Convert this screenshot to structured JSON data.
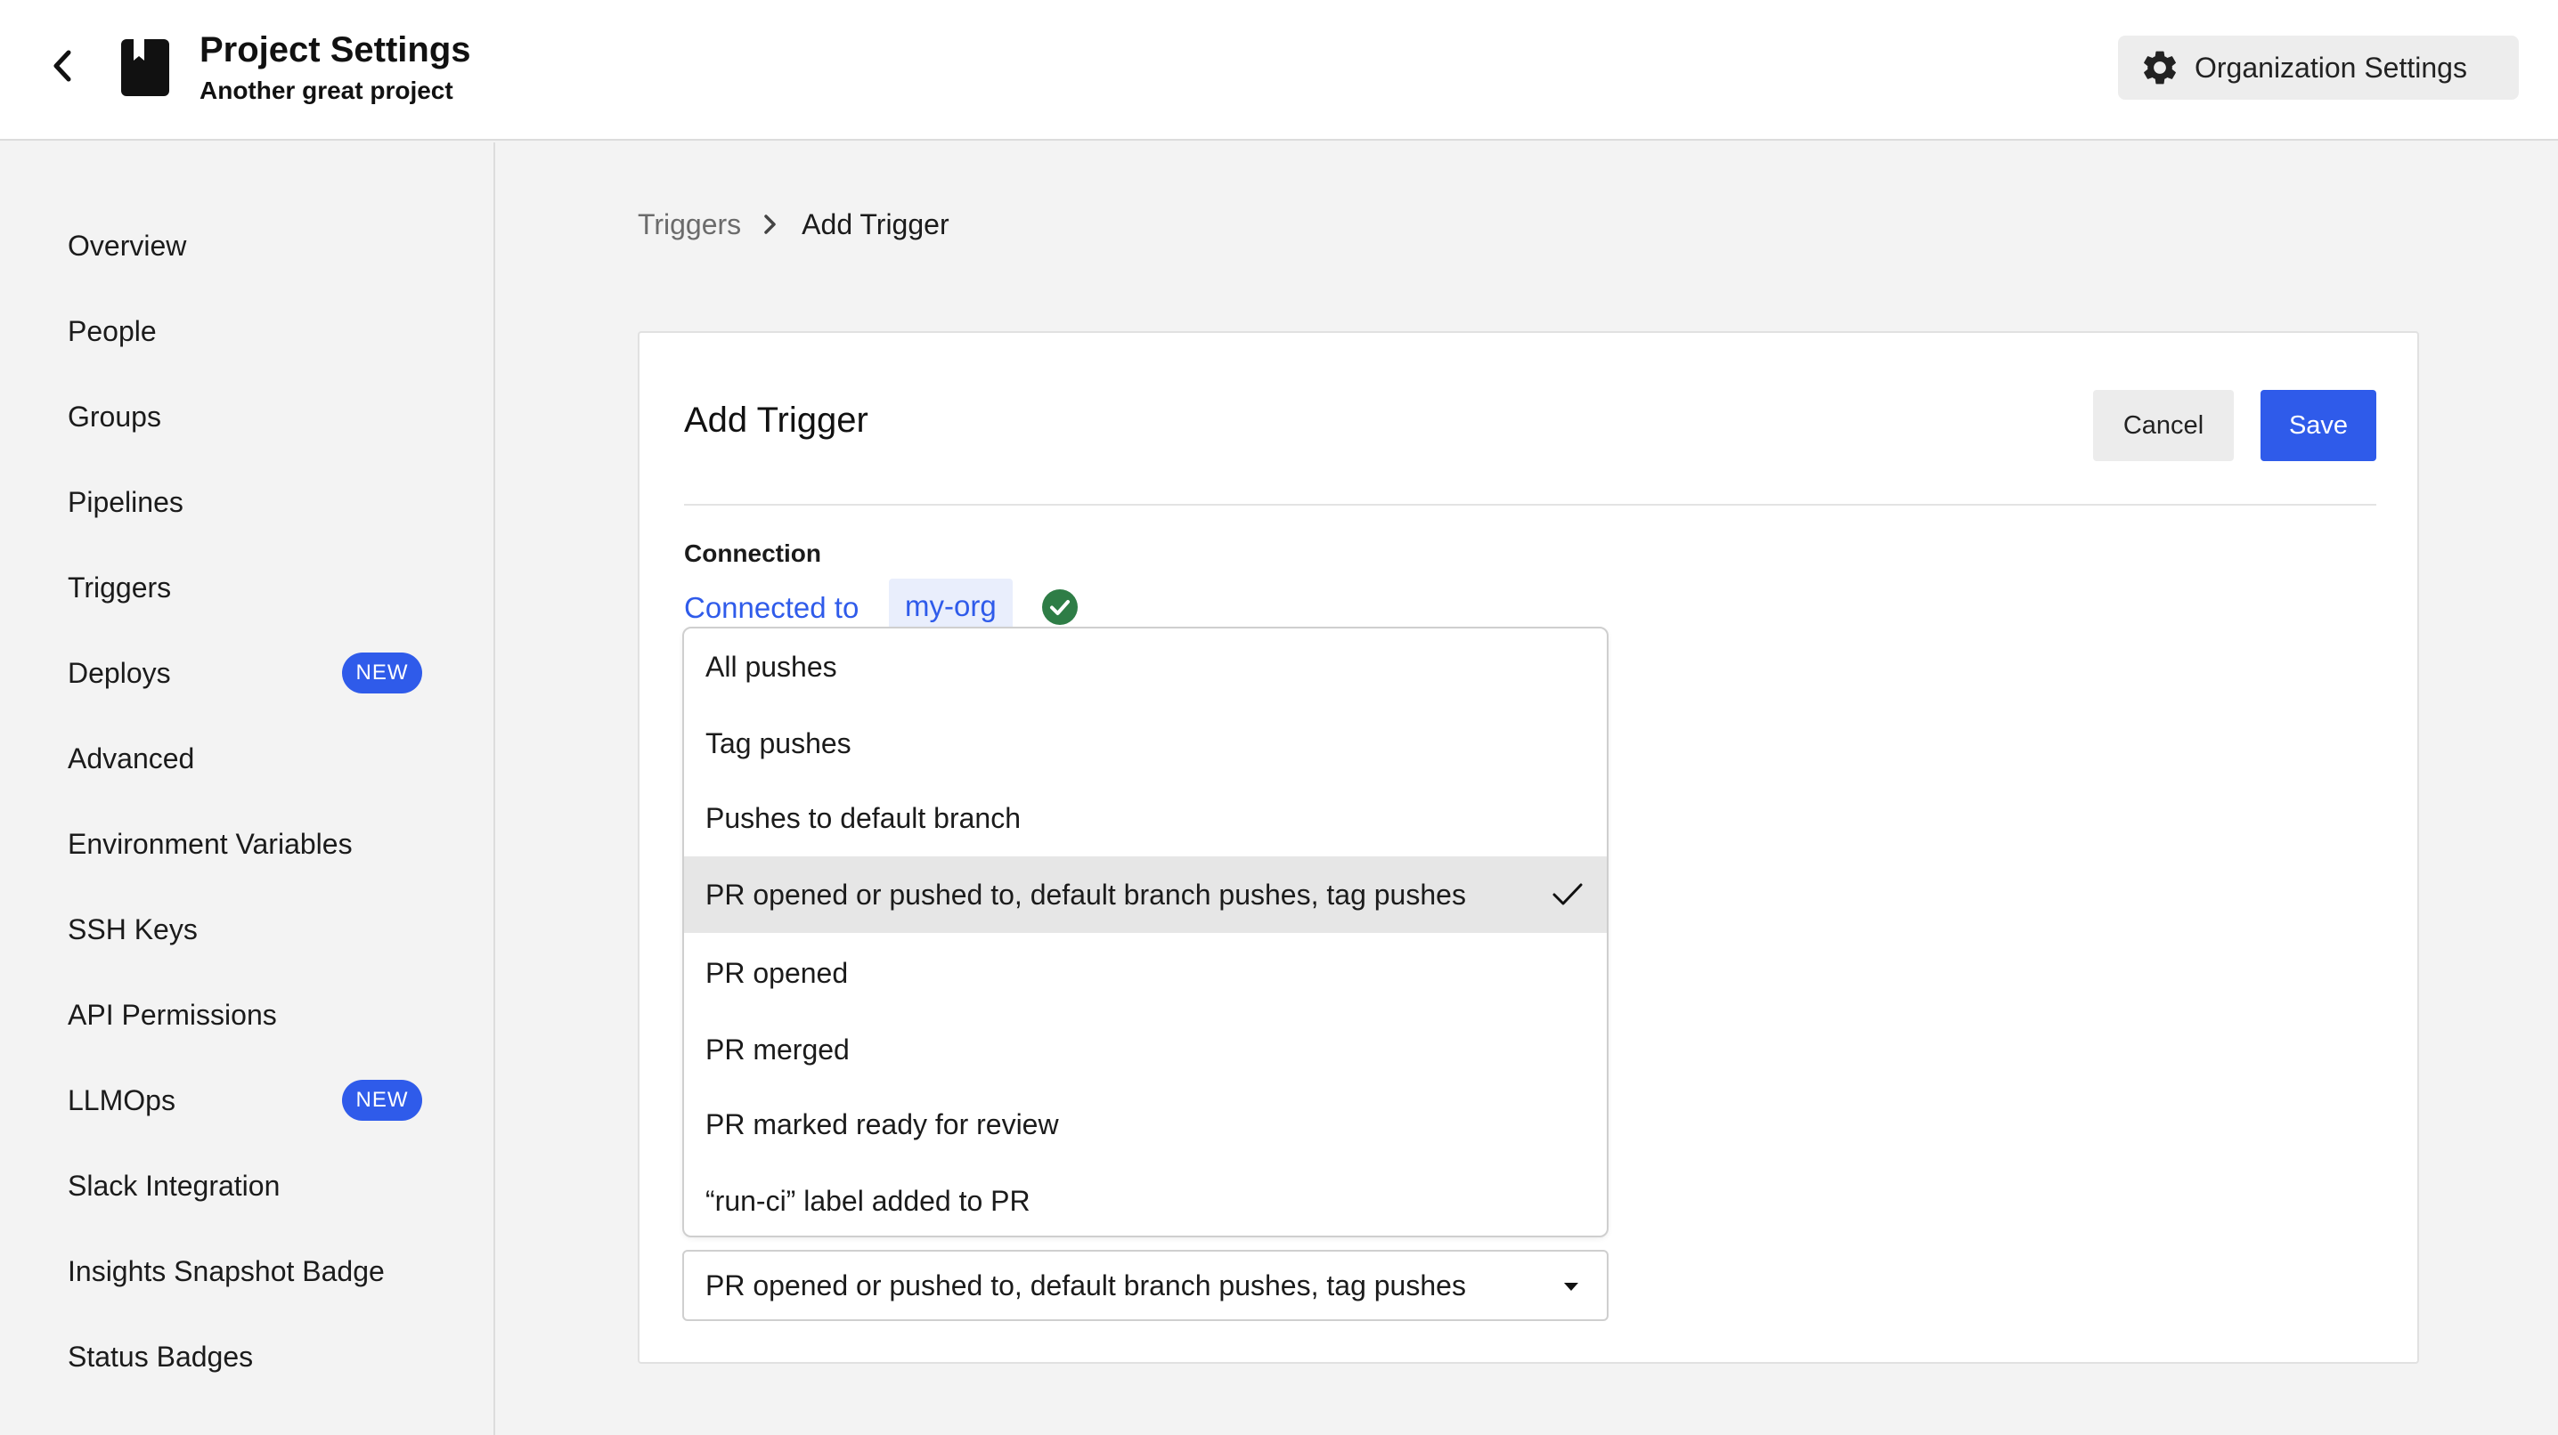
{
  "header": {
    "title": "Project Settings",
    "subtitle": "Another great project",
    "org_settings_label": "Organization Settings"
  },
  "sidebar": {
    "items": [
      {
        "label": "Overview"
      },
      {
        "label": "People"
      },
      {
        "label": "Groups"
      },
      {
        "label": "Pipelines"
      },
      {
        "label": "Triggers"
      },
      {
        "label": "Deploys",
        "badge": "NEW"
      },
      {
        "label": "Advanced"
      },
      {
        "label": "Environment Variables"
      },
      {
        "label": "SSH Keys"
      },
      {
        "label": "API Permissions"
      },
      {
        "label": "LLMOps",
        "badge": "NEW"
      },
      {
        "label": "Slack Integration"
      },
      {
        "label": "Insights Snapshot Badge"
      },
      {
        "label": "Status Badges"
      }
    ]
  },
  "breadcrumb": {
    "parent": "Triggers",
    "current": "Add Trigger"
  },
  "form": {
    "title": "Add Trigger",
    "cancel_label": "Cancel",
    "save_label": "Save",
    "connection_label": "Connection",
    "connected_text": "Connected to",
    "org_name": "my-org",
    "event_select": {
      "selected_value": "PR opened or pushed to, default branch pushes, tag pushes",
      "options": [
        "All pushes",
        "Tag pushes",
        "Pushes to default branch",
        "PR opened or pushed to, default branch pushes, tag pushes",
        "PR opened",
        "PR merged",
        "PR marked ready for review",
        "“run-ci” label added to PR"
      ],
      "selected_index": 3
    }
  },
  "colors": {
    "accent": "#2f5bea",
    "success": "#2e7d46",
    "page_bg": "#f3f3f3",
    "selected_option_bg": "#e6e6e6"
  },
  "icons": {
    "back": "chevron-left-icon",
    "project": "book-icon",
    "org_settings": "gear-icon",
    "breadcrumb_sep": "chevron-right-icon",
    "connection_status": "check-circle-icon",
    "selected_option": "checkmark-icon",
    "select_caret": "caret-down-icon"
  }
}
